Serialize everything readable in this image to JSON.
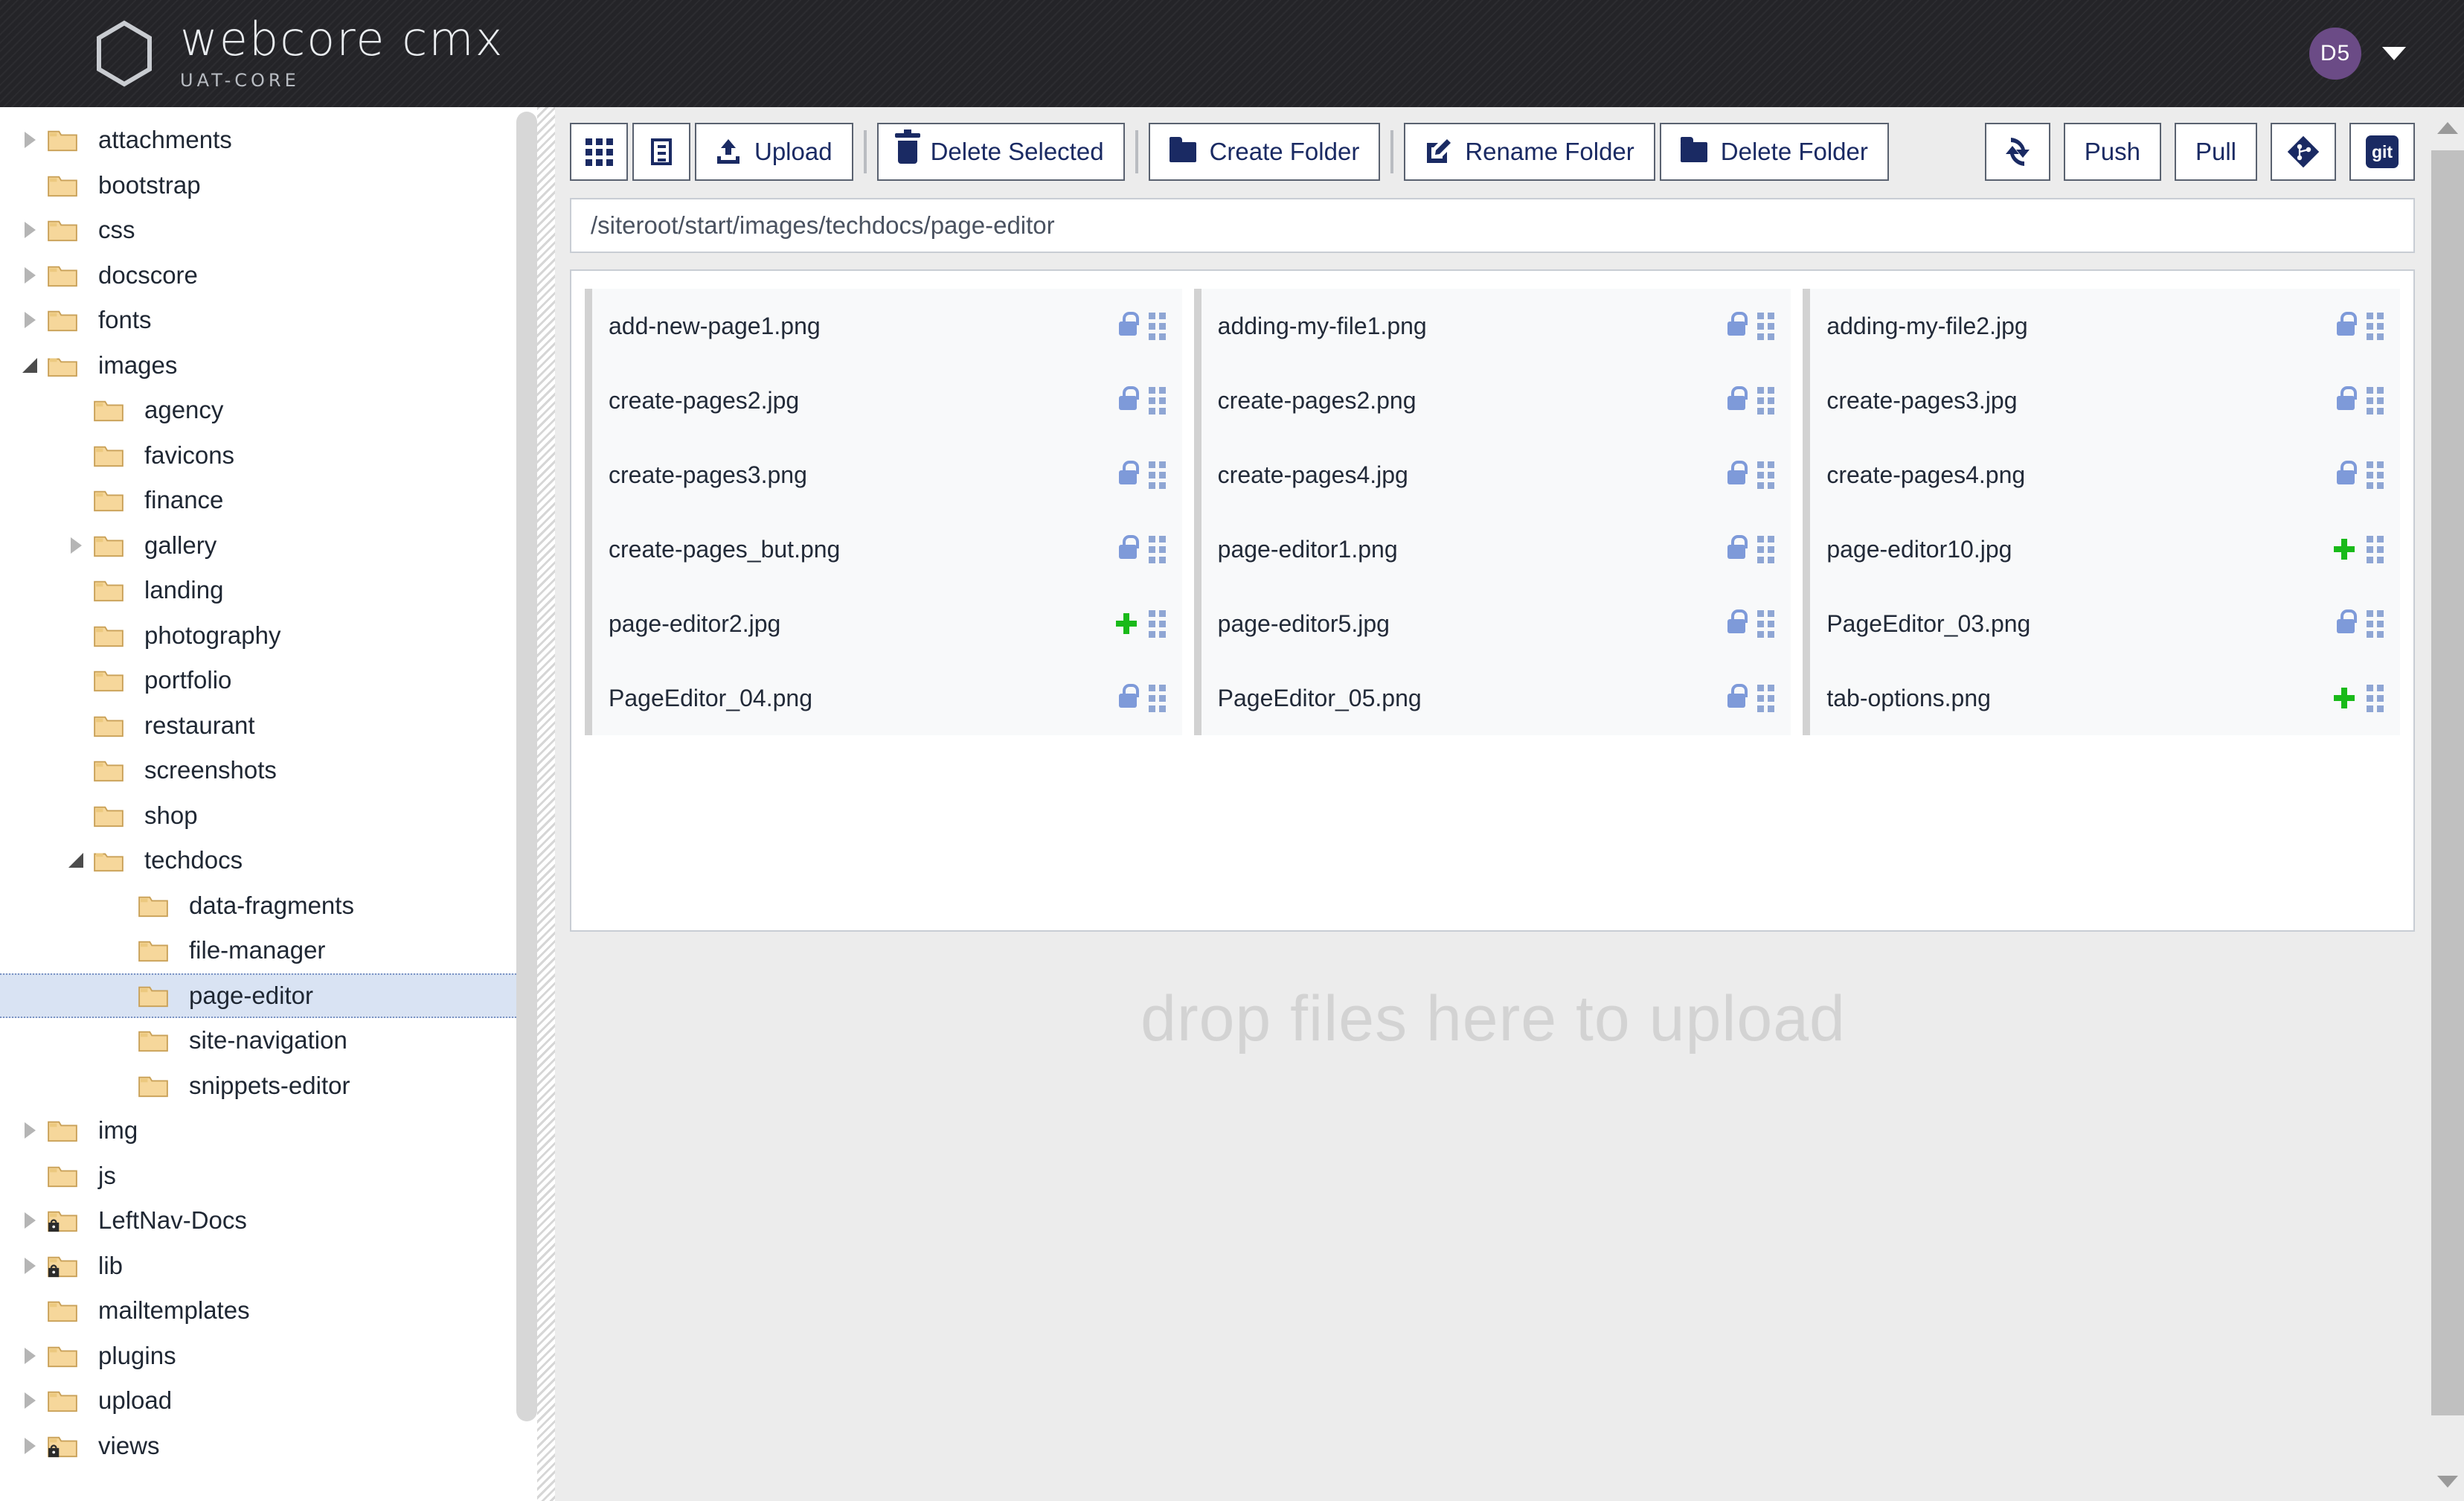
{
  "header": {
    "brand_title": "webcore cmx",
    "brand_subtitle": "UAT-CORE",
    "logo_icon": "hexagon-icon",
    "avatar_initials": "D5",
    "avatar_color": "#6b4b86",
    "caret_icon": "chevron-down-icon"
  },
  "sidebar": {
    "tree": [
      {
        "label": "attachments",
        "depth": 0,
        "state": "collapsed",
        "locked": false
      },
      {
        "label": "bootstrap",
        "depth": 0,
        "state": "leaf",
        "locked": false
      },
      {
        "label": "css",
        "depth": 0,
        "state": "collapsed",
        "locked": false
      },
      {
        "label": "docscore",
        "depth": 0,
        "state": "collapsed",
        "locked": false
      },
      {
        "label": "fonts",
        "depth": 0,
        "state": "collapsed",
        "locked": false
      },
      {
        "label": "images",
        "depth": 0,
        "state": "expanded",
        "locked": false
      },
      {
        "label": "agency",
        "depth": 1,
        "state": "leaf",
        "locked": false
      },
      {
        "label": "favicons",
        "depth": 1,
        "state": "leaf",
        "locked": false
      },
      {
        "label": "finance",
        "depth": 1,
        "state": "leaf",
        "locked": false
      },
      {
        "label": "gallery",
        "depth": 1,
        "state": "collapsed",
        "locked": false
      },
      {
        "label": "landing",
        "depth": 1,
        "state": "leaf",
        "locked": false
      },
      {
        "label": "photography",
        "depth": 1,
        "state": "leaf",
        "locked": false
      },
      {
        "label": "portfolio",
        "depth": 1,
        "state": "leaf",
        "locked": false
      },
      {
        "label": "restaurant",
        "depth": 1,
        "state": "leaf",
        "locked": false
      },
      {
        "label": "screenshots",
        "depth": 1,
        "state": "leaf",
        "locked": false
      },
      {
        "label": "shop",
        "depth": 1,
        "state": "leaf",
        "locked": false
      },
      {
        "label": "techdocs",
        "depth": 1,
        "state": "expanded",
        "locked": false
      },
      {
        "label": "data-fragments",
        "depth": 2,
        "state": "leaf",
        "locked": false
      },
      {
        "label": "file-manager",
        "depth": 2,
        "state": "leaf",
        "locked": false
      },
      {
        "label": "page-editor",
        "depth": 2,
        "state": "leaf",
        "locked": false,
        "selected": true
      },
      {
        "label": "site-navigation",
        "depth": 2,
        "state": "leaf",
        "locked": false
      },
      {
        "label": "snippets-editor",
        "depth": 2,
        "state": "leaf",
        "locked": false
      },
      {
        "label": "img",
        "depth": 0,
        "state": "collapsed",
        "locked": false
      },
      {
        "label": "js",
        "depth": 0,
        "state": "leaf",
        "locked": false
      },
      {
        "label": "LeftNav-Docs",
        "depth": 0,
        "state": "collapsed",
        "locked": true
      },
      {
        "label": "lib",
        "depth": 0,
        "state": "collapsed",
        "locked": true
      },
      {
        "label": "mailtemplates",
        "depth": 0,
        "state": "leaf",
        "locked": false
      },
      {
        "label": "plugins",
        "depth": 0,
        "state": "collapsed",
        "locked": false
      },
      {
        "label": "upload",
        "depth": 0,
        "state": "collapsed",
        "locked": false
      },
      {
        "label": "views",
        "depth": 0,
        "state": "collapsed",
        "locked": true
      }
    ]
  },
  "toolbar": {
    "grid_view_label": "",
    "grid_view_icon": "grid-view-icon",
    "detail_view_label": "",
    "detail_view_icon": "detail-view-icon",
    "upload_label": "Upload",
    "upload_icon": "upload-icon",
    "delete_selected_label": "Delete Selected",
    "delete_selected_icon": "trash-icon",
    "create_folder_label": "Create Folder",
    "create_folder_icon": "folder-icon",
    "rename_folder_label": "Rename Folder",
    "rename_folder_icon": "pencil-square-icon",
    "delete_folder_label": "Delete Folder",
    "delete_folder_icon": "folder-icon",
    "refresh_label": "",
    "refresh_icon": "refresh-icon",
    "push_label": "Push",
    "pull_label": "Pull",
    "git_diff_label": "",
    "git_diff_icon": "git-diamond-icon",
    "git_label": "git",
    "git_icon": "git-badge-icon"
  },
  "path_bar": {
    "value": "/siteroot/start/images/techdocs/page-editor"
  },
  "files": [
    {
      "name": "add-new-page1.png",
      "status": "locked"
    },
    {
      "name": "adding-my-file1.png",
      "status": "locked"
    },
    {
      "name": "adding-my-file2.jpg",
      "status": "locked"
    },
    {
      "name": "create-pages2.jpg",
      "status": "locked"
    },
    {
      "name": "create-pages2.png",
      "status": "locked"
    },
    {
      "name": "create-pages3.jpg",
      "status": "locked"
    },
    {
      "name": "create-pages3.png",
      "status": "locked"
    },
    {
      "name": "create-pages4.jpg",
      "status": "locked"
    },
    {
      "name": "create-pages4.png",
      "status": "locked"
    },
    {
      "name": "create-pages_but.png",
      "status": "locked"
    },
    {
      "name": "page-editor1.png",
      "status": "locked"
    },
    {
      "name": "page-editor10.jpg",
      "status": "new"
    },
    {
      "name": "page-editor2.jpg",
      "status": "new"
    },
    {
      "name": "page-editor5.jpg",
      "status": "locked"
    },
    {
      "name": "PageEditor_03.png",
      "status": "locked"
    },
    {
      "name": "PageEditor_04.png",
      "status": "locked"
    },
    {
      "name": "PageEditor_05.png",
      "status": "locked"
    },
    {
      "name": "tab-options.png",
      "status": "new"
    }
  ],
  "dropzone": {
    "text": "drop files here to upload"
  },
  "colors": {
    "accent_navy": "#1a2a63",
    "lock_blue": "#7e9ad9",
    "new_green": "#19ba19",
    "selected_row": "#d9e3f3",
    "header_bg": "#242428"
  }
}
